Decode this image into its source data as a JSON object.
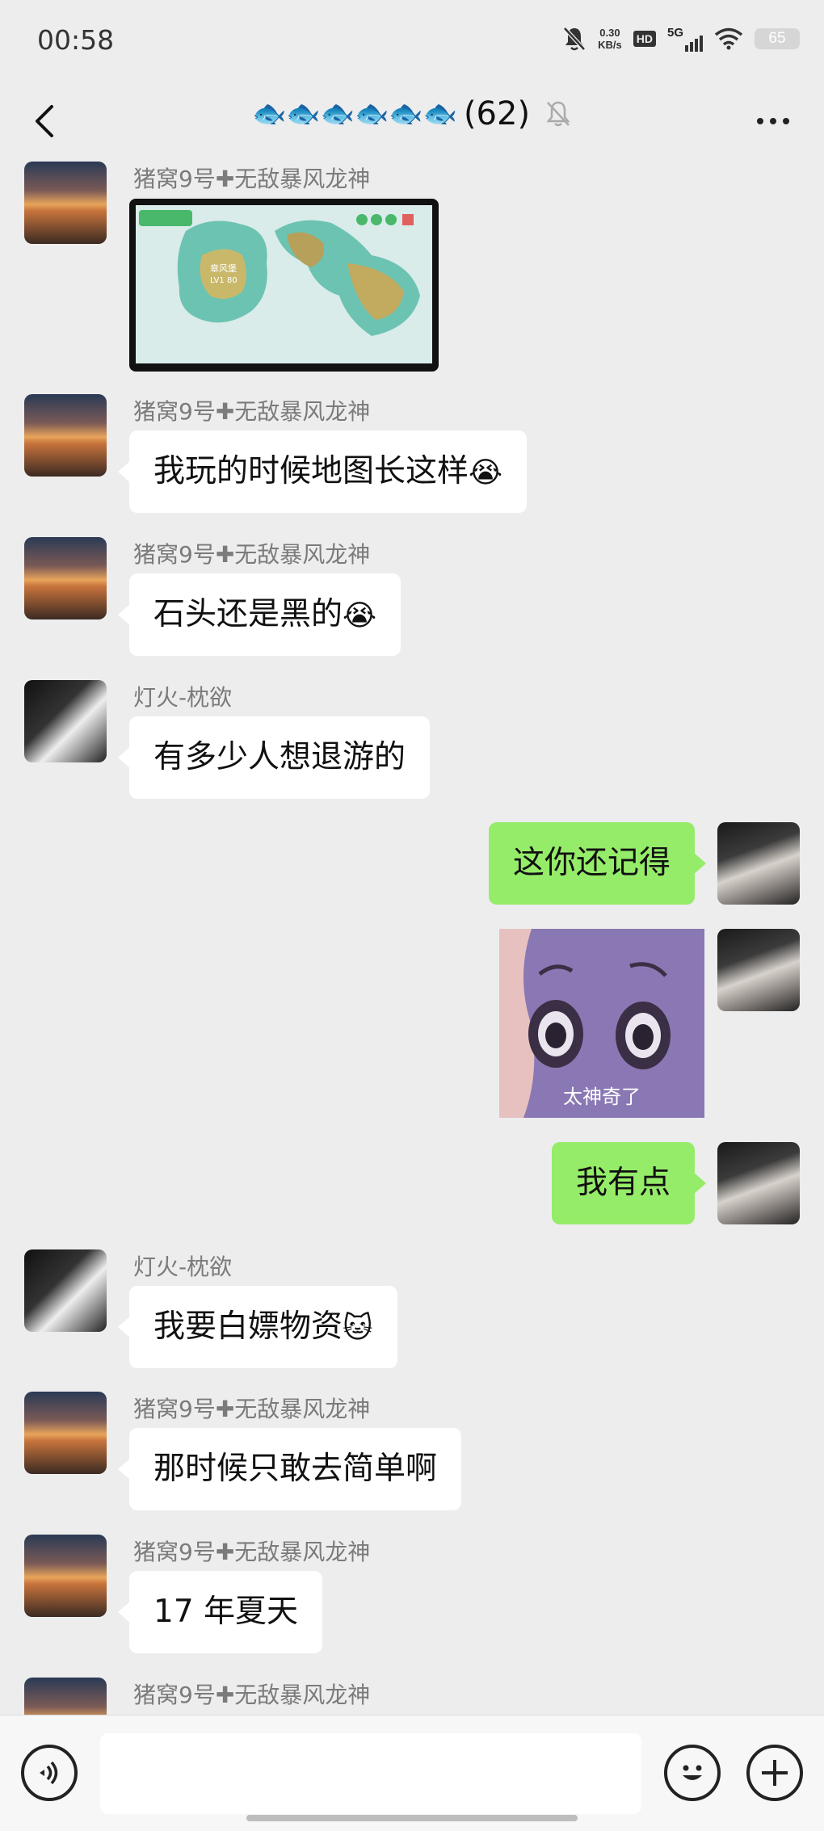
{
  "status_bar": {
    "time": "00:58",
    "speed_value": "0.30",
    "speed_unit": "KB/s",
    "hd": "HD",
    "network": "5G",
    "battery": "65"
  },
  "header": {
    "title_emojis": "🐟🐟🐟🐟🐟🐟",
    "count": "(62)"
  },
  "messages": [
    {
      "sender": "猪窝9号✚无敌暴风龙神",
      "text": ""
    },
    {
      "sender": "猪窝9号✚无敌暴风龙神",
      "text": "我玩的时候地图长这样",
      "emoji": "😭"
    },
    {
      "sender": "猪窝9号✚无敌暴风龙神",
      "text": "石头还是黑的",
      "emoji": "😭"
    },
    {
      "sender": "灯火-枕欲",
      "text": "有多少人想退游的"
    },
    {
      "text": "这你还记得"
    },
    {
      "sticker_caption": "太神奇了"
    },
    {
      "text": "我有点"
    },
    {
      "sender": "灯火-枕欲",
      "text": "我要白嫖物资",
      "emoji": "🐱"
    },
    {
      "sender": "猪窝9号✚无敌暴风龙神",
      "text": "那时候只敢去简单啊"
    },
    {
      "sender": "猪窝9号✚无敌暴风龙神",
      "text": "17 年夏天"
    },
    {
      "sender": "猪窝9号✚无敌暴风龙神"
    }
  ],
  "map_image": {
    "label": "章风堡",
    "level": "LV1 80"
  }
}
